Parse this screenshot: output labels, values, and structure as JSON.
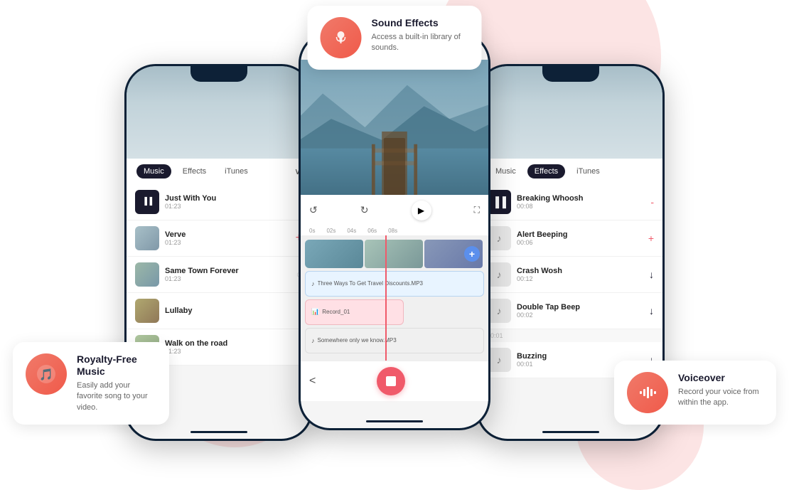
{
  "page": {
    "bg_color": "#ffffff"
  },
  "left_phone": {
    "tabs": [
      "Music",
      "Effects",
      "iTunes"
    ],
    "active_tab": "Music",
    "tracks": [
      {
        "title": "Just With You",
        "duration": "01:23",
        "action": "pause",
        "action_icon": "▐▐"
      },
      {
        "title": "Verve",
        "duration": "01:23",
        "action": "add",
        "action_icon": "+"
      },
      {
        "title": "Same Town Forever",
        "duration": "01:23",
        "action": "loading",
        "action_icon": "◌"
      },
      {
        "title": "Lullaby",
        "duration": "",
        "action": "download",
        "action_icon": "↓"
      },
      {
        "title": "Walk on the road",
        "duration": "01:23",
        "action": "download",
        "action_icon": "↓"
      }
    ]
  },
  "center_phone": {
    "timeline_markers": [
      "0s",
      "02s",
      "04s",
      "06s",
      "08s"
    ],
    "tracks": [
      {
        "name": "Three Ways To Get Travel Discounts.MP3",
        "type": "music"
      },
      {
        "name": "Record_01",
        "type": "record"
      },
      {
        "name": "Somewhere only we know.MP3",
        "type": "music2"
      }
    ]
  },
  "right_phone": {
    "tabs": [
      "Music",
      "Effects",
      "iTunes"
    ],
    "active_tab": "Effects",
    "effects": [
      {
        "title": "Breaking Whoosh",
        "duration": "00:08",
        "action": "pause",
        "action_icon": "▐▐"
      },
      {
        "title": "Alert Beeping",
        "duration": "00:06",
        "action": "add",
        "action_icon": "+"
      },
      {
        "title": "Crash Wosh",
        "duration": "00:12",
        "action": "download",
        "action_icon": "↓"
      },
      {
        "title": "Double Tap Beep",
        "duration": "00:02",
        "action": "download",
        "action_icon": "↓"
      },
      {
        "title": "Buzzing",
        "duration": "00:01",
        "action": "download",
        "action_icon": "↓"
      }
    ]
  },
  "features": {
    "music": {
      "title": "Royalty-Free\nMusic",
      "description": "Easily add your favorite song to your video.",
      "icon": "🎵"
    },
    "sound_effects": {
      "title": "Sound Effects",
      "description": "Access a built-in library of sounds.",
      "icon": "🎙"
    },
    "voiceover": {
      "title": "Voiceover",
      "description": "Record your voice from within the app.",
      "icon": "🎤"
    }
  }
}
